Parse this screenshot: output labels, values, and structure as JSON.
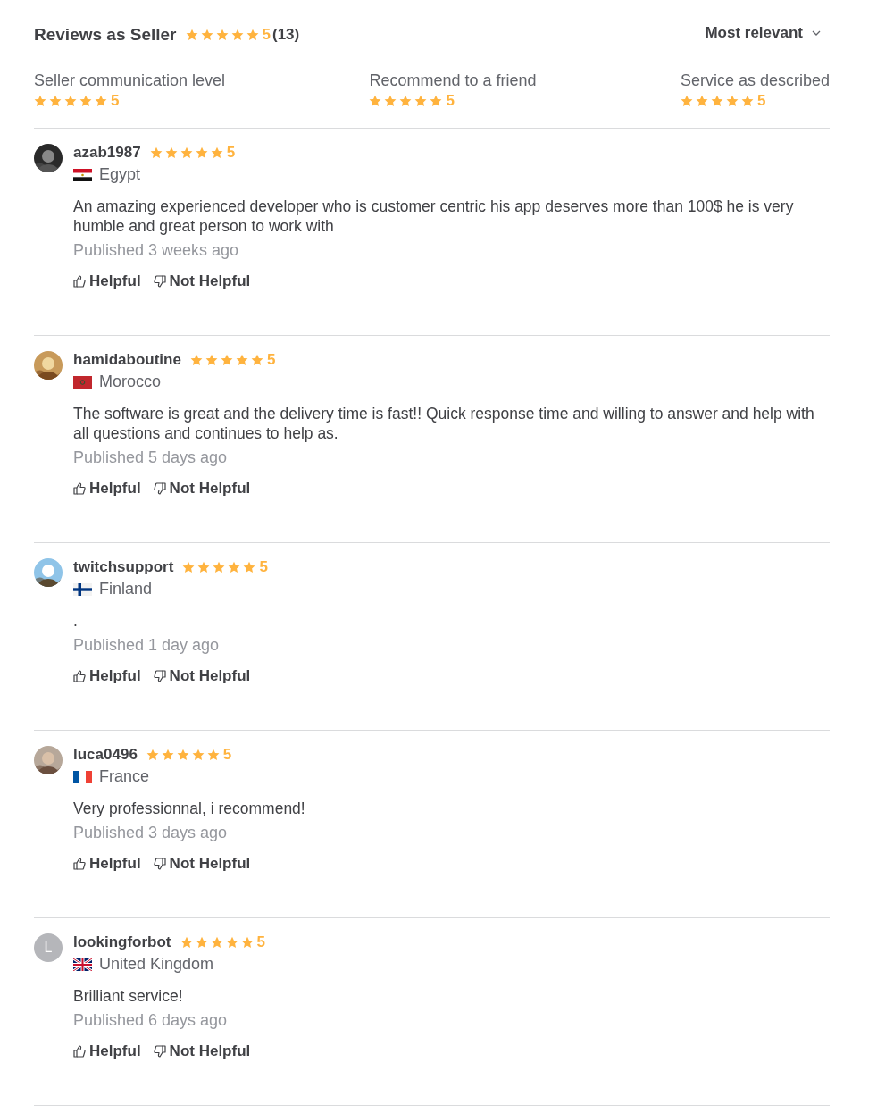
{
  "header": {
    "title": "Reviews as Seller",
    "stars": 5,
    "rating": "5",
    "count": "(13)",
    "sort": "Most relevant"
  },
  "summary": [
    {
      "label": "Seller communication level",
      "stars": 5,
      "rating": "5"
    },
    {
      "label": "Recommend to a friend",
      "stars": 5,
      "rating": "5"
    },
    {
      "label": "Service as described",
      "stars": 5,
      "rating": "5"
    }
  ],
  "reviews": [
    {
      "username": "azab1987",
      "stars": 5,
      "rating": "5",
      "country": "Egypt",
      "text": "An amazing experienced developer who is customer centric his app deserves more than 100$ he is very humble and great person to work with",
      "published": "Published 3 weeks ago",
      "helpful": "Helpful",
      "not_helpful": "Not Helpful"
    },
    {
      "username": "hamidaboutine",
      "stars": 5,
      "rating": "5",
      "country": "Morocco",
      "text": "The software is great and the delivery time is fast!! Quick response time and willing to answer and help with all questions and continues to help as.",
      "published": "Published 5 days ago",
      "helpful": "Helpful",
      "not_helpful": "Not Helpful"
    },
    {
      "username": "twitchsupport",
      "stars": 5,
      "rating": "5",
      "country": "Finland",
      "text": ".",
      "published": "Published 1 day ago",
      "helpful": "Helpful",
      "not_helpful": "Not Helpful"
    },
    {
      "username": "luca0496",
      "stars": 5,
      "rating": "5",
      "country": "France",
      "text": "Very professionnal, i recommend!",
      "published": "Published 3 days ago",
      "helpful": "Helpful",
      "not_helpful": "Not Helpful"
    },
    {
      "avatar": {
        "kind": "letter",
        "letter": "L"
      },
      "username": "lookingforbot",
      "stars": 5,
      "rating": "5",
      "country": "United Kingdom",
      "text": "Brilliant service!",
      "published": "Published 6 days ago",
      "helpful": "Helpful",
      "not_helpful": "Not Helpful"
    }
  ]
}
